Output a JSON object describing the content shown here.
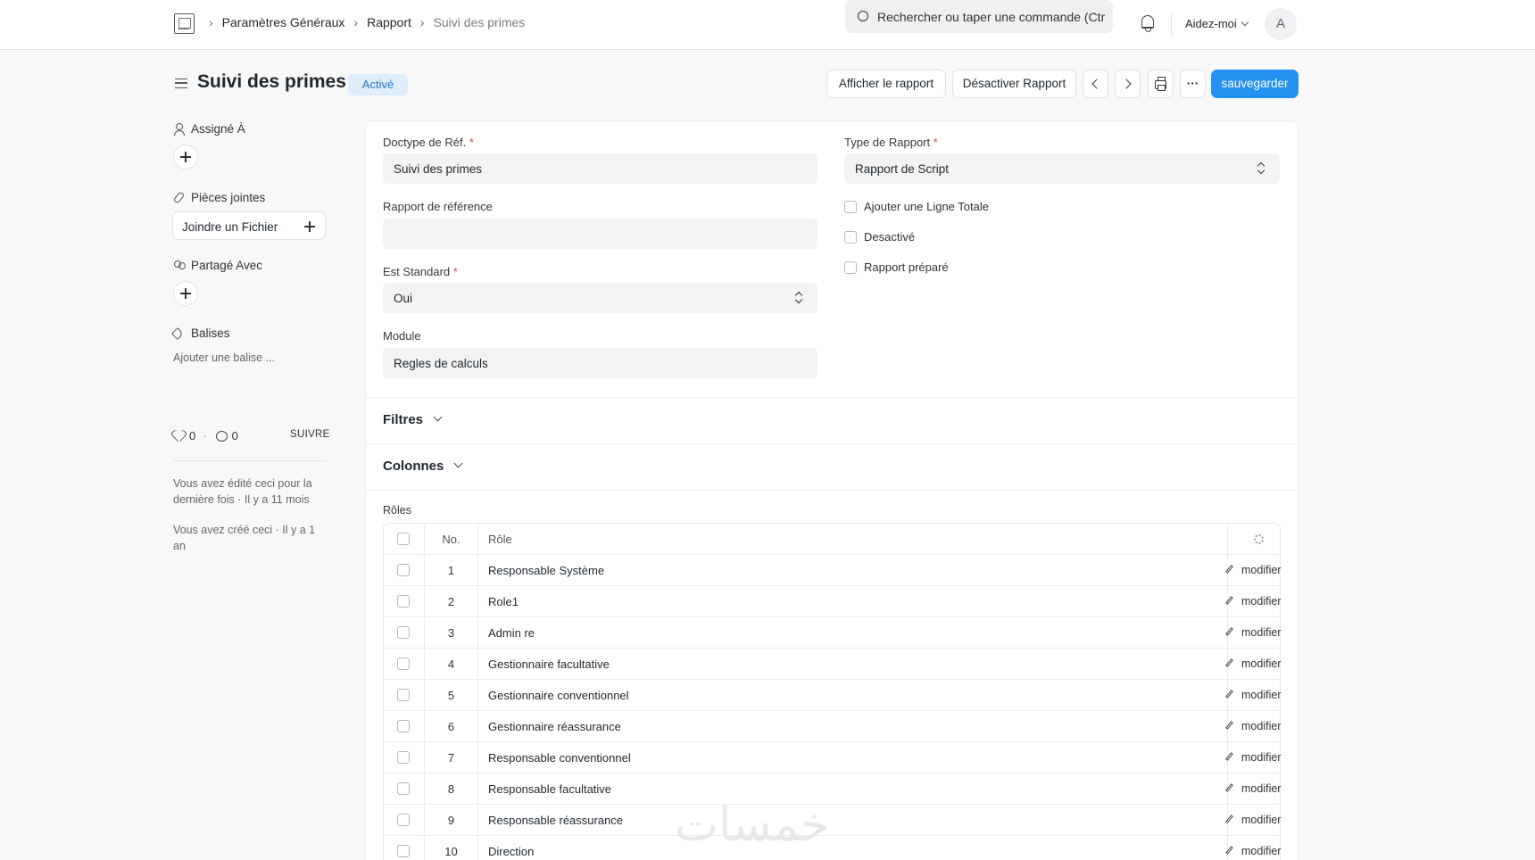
{
  "breadcrumbs": [
    "Paramètres Généraux",
    "Rapport",
    "Suivi des primes"
  ],
  "search": {
    "placeholder": "Rechercher ou taper une commande (Ctrl + G)"
  },
  "help_menu": "Aidez-moi",
  "user_initial": "A",
  "page": {
    "title": "Suivi des primes",
    "status": "Activé"
  },
  "actions": {
    "show_report": "Afficher le rapport",
    "disable_report": "Désactiver Rapport",
    "more": "···",
    "save": "sauvegarder"
  },
  "sidebar": {
    "assigned_to": "Assigné À",
    "attachments": "Pièces jointes",
    "attach_file": "Joindre un Fichier",
    "shared_with": "Partagé Avec",
    "tags": "Balises",
    "add_tag": "Ajouter une balise ...",
    "likes": "0",
    "comments": "0",
    "follow": "SUIVRE",
    "edited": "Vous avez édité ceci pour la dernière fois · Il y a 11 mois",
    "created": "Vous avez créé ceci · Il y a 1 an"
  },
  "form": {
    "ref_doctype": {
      "label": "Doctype de Réf.",
      "value": "Suivi des primes"
    },
    "ref_report": {
      "label": "Rapport de référence",
      "value": ""
    },
    "is_standard": {
      "label": "Est Standard",
      "value": "Oui"
    },
    "module": {
      "label": "Module",
      "value": "Regles de calculs"
    },
    "report_type": {
      "label": "Type de Rapport",
      "value": "Rapport de Script"
    },
    "checkboxes": [
      "Ajouter une Ligne Totale",
      "Desactivé",
      "Rapport préparé"
    ]
  },
  "sections": {
    "filters": "Filtres",
    "columns": "Colonnes"
  },
  "roles": {
    "label": "Rôles",
    "header": {
      "no": "No.",
      "role": "Rôle"
    },
    "edit_label": "modifier",
    "rows": [
      {
        "no": "1",
        "role": "Responsable Système"
      },
      {
        "no": "2",
        "role": "Role1"
      },
      {
        "no": "3",
        "role": "Admin re"
      },
      {
        "no": "4",
        "role": "Gestionnaire facultative"
      },
      {
        "no": "5",
        "role": "Gestionnaire conventionnel"
      },
      {
        "no": "6",
        "role": "Gestionnaire réassurance"
      },
      {
        "no": "7",
        "role": "Responsable conventionnel"
      },
      {
        "no": "8",
        "role": "Responsable facultative"
      },
      {
        "no": "9",
        "role": "Responsable réassurance"
      },
      {
        "no": "10",
        "role": "Direction"
      }
    ]
  },
  "watermark": "خمسات",
  "colors": {
    "primary": "#2490ef",
    "badge_bg": "#dfeefd",
    "badge_text": "#2d73c2"
  }
}
